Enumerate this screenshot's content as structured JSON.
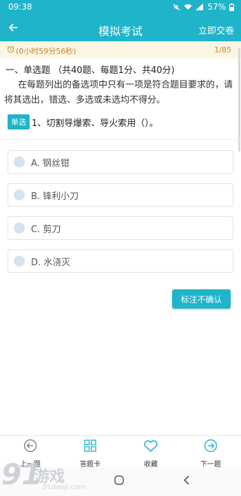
{
  "status_bar": {
    "time": "09:38",
    "battery": "57%"
  },
  "header": {
    "title": "模拟考试",
    "submit_label": "立即交卷"
  },
  "timer": {
    "remaining": "(0小时59分56秒)",
    "progress": "1/85"
  },
  "section": {
    "heading": "一、单选题 （共40题、每题1分、共40分)",
    "instructions": "在每题列出的备选项中只有一项是符合题目要求的，请将其选出，错选、多选或未选均不得分。"
  },
  "question": {
    "badge": "单选",
    "text": "1、切割导爆索、导火索用（）。"
  },
  "options": [
    {
      "label": "A.  钢丝钳"
    },
    {
      "label": "B.  锋利小刀"
    },
    {
      "label": "C.  剪刀"
    },
    {
      "label": "D.  水浇灭"
    }
  ],
  "mark_button": "标注不确认",
  "bottom_nav": [
    {
      "label": "上一题",
      "icon": "arrow-left-circle-icon"
    },
    {
      "label": "答题卡",
      "icon": "grid-icon"
    },
    {
      "label": "收藏",
      "icon": "heart-icon"
    },
    {
      "label": "下一题",
      "icon": "arrow-right-circle-icon"
    }
  ],
  "watermark": {
    "logo": "91",
    "name": "游戏",
    "domain": "91danji.com"
  },
  "colors": {
    "accent": "#1fb4c9",
    "timer_text": "#c8842c",
    "timer_bg": "#fbf6e3"
  }
}
